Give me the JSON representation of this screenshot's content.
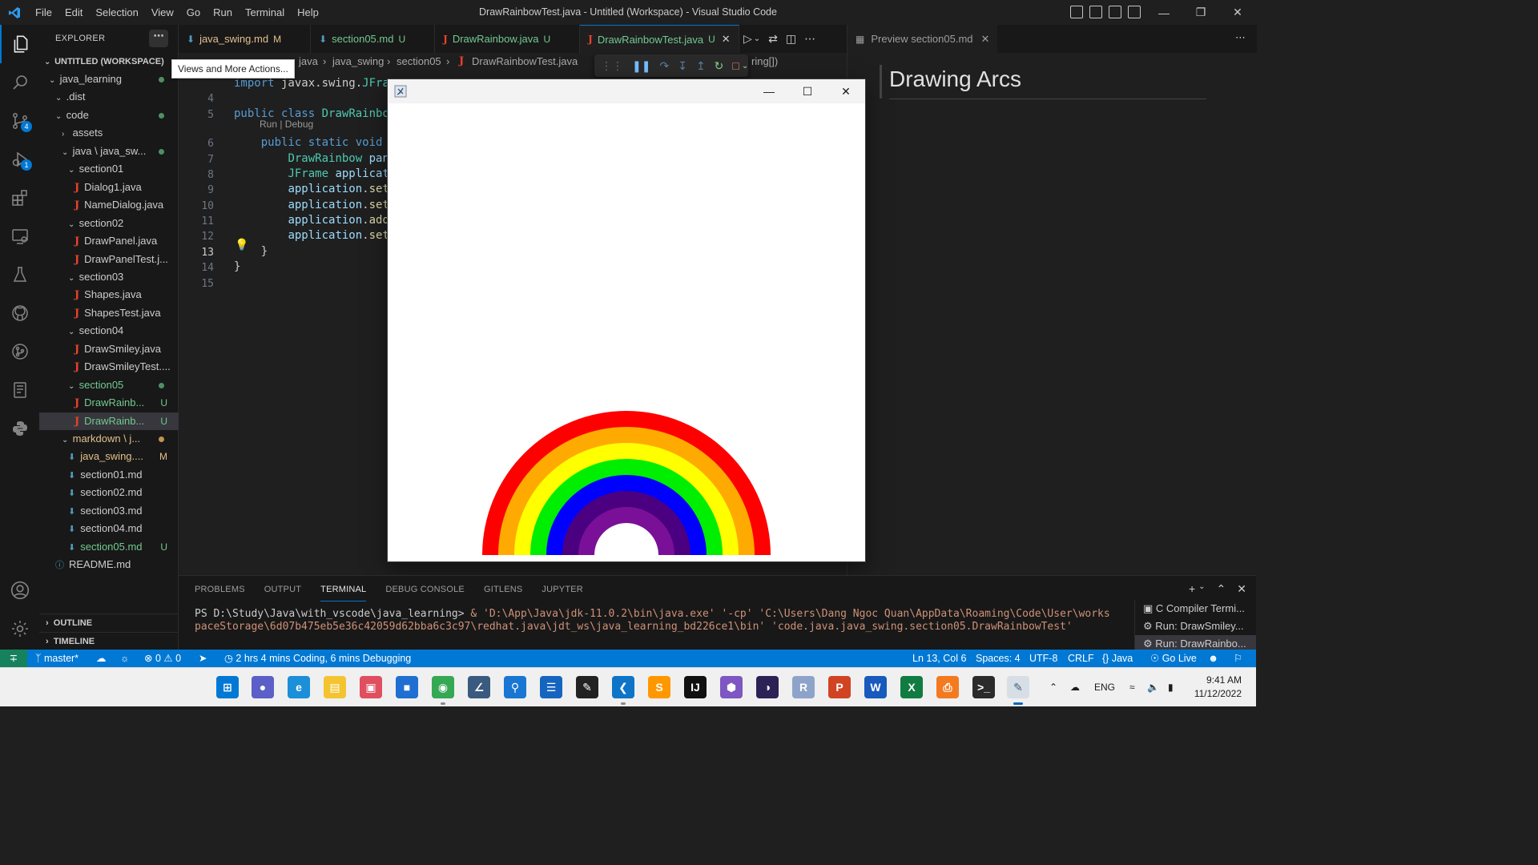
{
  "titlebar": {
    "menu": [
      "File",
      "Edit",
      "Selection",
      "View",
      "Go",
      "Run",
      "Terminal",
      "Help"
    ],
    "window_title": "DrawRainbowTest.java - Untitled (Workspace) - Visual Studio Code"
  },
  "activity": {
    "scm_badge": "4",
    "debug_badge": "1"
  },
  "sidebar": {
    "header": "EXPLORER",
    "more": "⋯",
    "workspace": "UNTITLED (WORKSPACE)",
    "tree": [
      {
        "label": "java_learning",
        "kind": "folder",
        "open": true,
        "indent": 1,
        "dot": true
      },
      {
        "label": ".dist",
        "kind": "folder",
        "open": true,
        "indent": 2
      },
      {
        "label": "code",
        "kind": "folder",
        "open": true,
        "indent": 2,
        "dot": true
      },
      {
        "label": "assets",
        "kind": "folder",
        "open": false,
        "indent": 3
      },
      {
        "label": "java \\ java_sw...",
        "kind": "folder",
        "open": true,
        "indent": 3,
        "dot": true
      },
      {
        "label": "section01",
        "kind": "folder",
        "open": true,
        "indent": 4
      },
      {
        "label": "Dialog1.java",
        "kind": "java",
        "indent": 5
      },
      {
        "label": "NameDialog.java",
        "kind": "java",
        "indent": 5
      },
      {
        "label": "section02",
        "kind": "folder",
        "open": true,
        "indent": 4
      },
      {
        "label": "DrawPanel.java",
        "kind": "java",
        "indent": 5
      },
      {
        "label": "DrawPanelTest.j...",
        "kind": "java",
        "indent": 5
      },
      {
        "label": "section03",
        "kind": "folder",
        "open": true,
        "indent": 4
      },
      {
        "label": "Shapes.java",
        "kind": "java",
        "indent": 5
      },
      {
        "label": "ShapesTest.java",
        "kind": "java",
        "indent": 5
      },
      {
        "label": "section04",
        "kind": "folder",
        "open": true,
        "indent": 4
      },
      {
        "label": "DrawSmiley.java",
        "kind": "java",
        "indent": 5
      },
      {
        "label": "DrawSmileyTest....",
        "kind": "java",
        "indent": 5
      },
      {
        "label": "section05",
        "kind": "folder",
        "open": true,
        "indent": 4,
        "color": "green",
        "dot": true
      },
      {
        "label": "DrawRainb...",
        "kind": "java",
        "indent": 5,
        "color": "green",
        "status": "U"
      },
      {
        "label": "DrawRainb...",
        "kind": "java",
        "indent": 5,
        "color": "green",
        "status": "U",
        "selected": true
      },
      {
        "label": "markdown \\ j...",
        "kind": "folder",
        "open": true,
        "indent": 3,
        "color": "yellow",
        "dot": true
      },
      {
        "label": "java_swing....",
        "kind": "md",
        "indent": 4,
        "color": "yellow",
        "status": "M"
      },
      {
        "label": "section01.md",
        "kind": "md",
        "indent": 4
      },
      {
        "label": "section02.md",
        "kind": "md",
        "indent": 4
      },
      {
        "label": "section03.md",
        "kind": "md",
        "indent": 4
      },
      {
        "label": "section04.md",
        "kind": "md",
        "indent": 4
      },
      {
        "label": "section05.md",
        "kind": "md",
        "indent": 4,
        "color": "green",
        "status": "U"
      },
      {
        "label": "README.md",
        "kind": "info",
        "indent": 2
      }
    ],
    "outline": "OUTLINE",
    "timeline": "TIMELINE"
  },
  "tooltip": "Views and More Actions...",
  "tabs": [
    {
      "icon": "⬇",
      "label": "java_swing.md",
      "status": "M",
      "color": "yellow"
    },
    {
      "icon": "⬇",
      "label": "section05.md",
      "status": "U",
      "color": "green"
    },
    {
      "icon": "J",
      "label": "DrawRainbow.java",
      "status": "U",
      "color": "green"
    },
    {
      "icon": "J",
      "label": "DrawRainbowTest.java",
      "status": "U",
      "color": "green",
      "active": true
    }
  ],
  "breadcrumb": {
    "parts": [
      "java",
      "java_swing",
      "section05",
      "DrawRainbowTest.java"
    ],
    "tail": "ring[])"
  },
  "code": {
    "lines": [
      {
        "n": "",
        "text": "import javax.swing.JFrame;"
      },
      {
        "n": "4",
        "text": ""
      },
      {
        "n": "5",
        "text": "public class DrawRainbowT"
      },
      {
        "n": "6",
        "text": "    public static void ma"
      },
      {
        "n": "7",
        "text": "        DrawRainbow pane"
      },
      {
        "n": "8",
        "text": "        JFrame applicatio"
      },
      {
        "n": "9",
        "text": "        application.setDe"
      },
      {
        "n": "10",
        "text": "        application.setS"
      },
      {
        "n": "11",
        "text": "        application.add(p"
      },
      {
        "n": "12",
        "text": "        application.setV"
      },
      {
        "n": "13",
        "text": "    }"
      },
      {
        "n": "14",
        "text": "}"
      },
      {
        "n": "15",
        "text": ""
      }
    ],
    "codelens": "Run | Debug"
  },
  "preview": {
    "tab": "Preview section05.md",
    "heading": "Drawing Arcs"
  },
  "panel": {
    "tabs": [
      "PROBLEMS",
      "OUTPUT",
      "TERMINAL",
      "DEBUG CONSOLE",
      "GITLENS",
      "JUPYTER"
    ],
    "active_tab": "TERMINAL",
    "prompt": "PS D:\\Study\\Java\\with_vscode\\java_learning> ",
    "command": "& 'D:\\App\\Java\\jdk-11.0.2\\bin\\java.exe' '-cp' 'C:\\Users\\Dang Ngoc Quan\\AppData\\Roaming\\Code\\User\\workspaceStorage\\6d07b475eb5e36c42059d62bba6c3c97\\redhat.java\\jdt_ws\\java_learning_bd226ce1\\bin' 'code.java.java_swing.section05.DrawRainbowTest'",
    "terminals": [
      "C Compiler Termi...",
      "Run: DrawSmiley...",
      "Run: DrawRainbo..."
    ]
  },
  "statusbar": {
    "branch": "master*",
    "errors": "0",
    "warnings": "0",
    "coding": "2 hrs 4 mins Coding, 6 mins Debugging",
    "position": "Ln 13, Col 6",
    "spaces": "Spaces: 4",
    "encoding": "UTF-8",
    "eol": "CRLF",
    "language": "Java",
    "golive": "Go Live"
  },
  "taskbar": {
    "lang": "ENG",
    "time": "9:41 AM",
    "date": "11/12/2022"
  },
  "rainbow": {
    "colors": [
      "#ff0000",
      "#ffaa00",
      "#ffff00",
      "#00ee00",
      "#0000ff",
      "#4b0082",
      "#7a1097"
    ]
  }
}
